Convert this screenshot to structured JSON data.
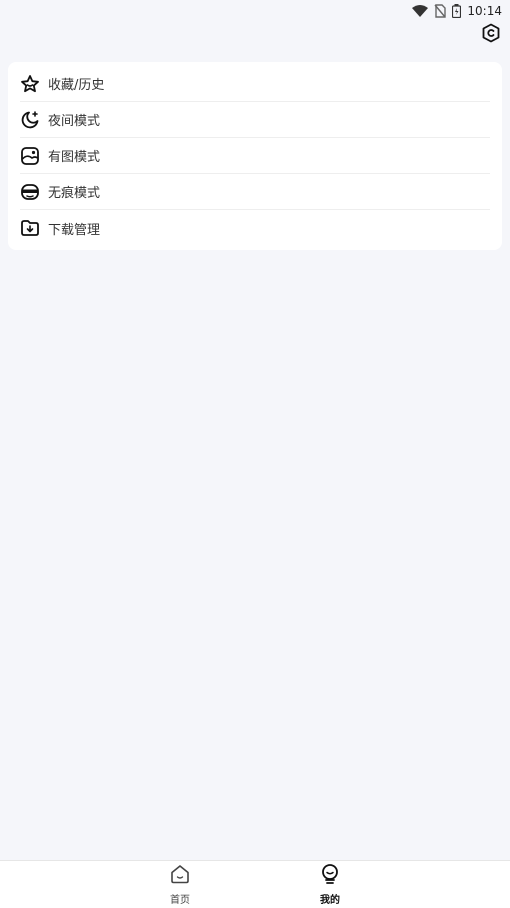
{
  "status_bar": {
    "time": "10:14"
  },
  "menu": {
    "items": [
      {
        "label": "收藏/历史",
        "icon": "favorite-history-icon"
      },
      {
        "label": "夜间模式",
        "icon": "night-mode-icon"
      },
      {
        "label": "有图模式",
        "icon": "image-mode-icon"
      },
      {
        "label": "无痕模式",
        "icon": "incognito-mode-icon"
      },
      {
        "label": "下载管理",
        "icon": "download-manager-icon"
      }
    ]
  },
  "bottom_nav": {
    "items": [
      {
        "label": "首页",
        "icon": "home-icon",
        "active": false
      },
      {
        "label": "我的",
        "icon": "profile-icon",
        "active": true
      }
    ]
  }
}
